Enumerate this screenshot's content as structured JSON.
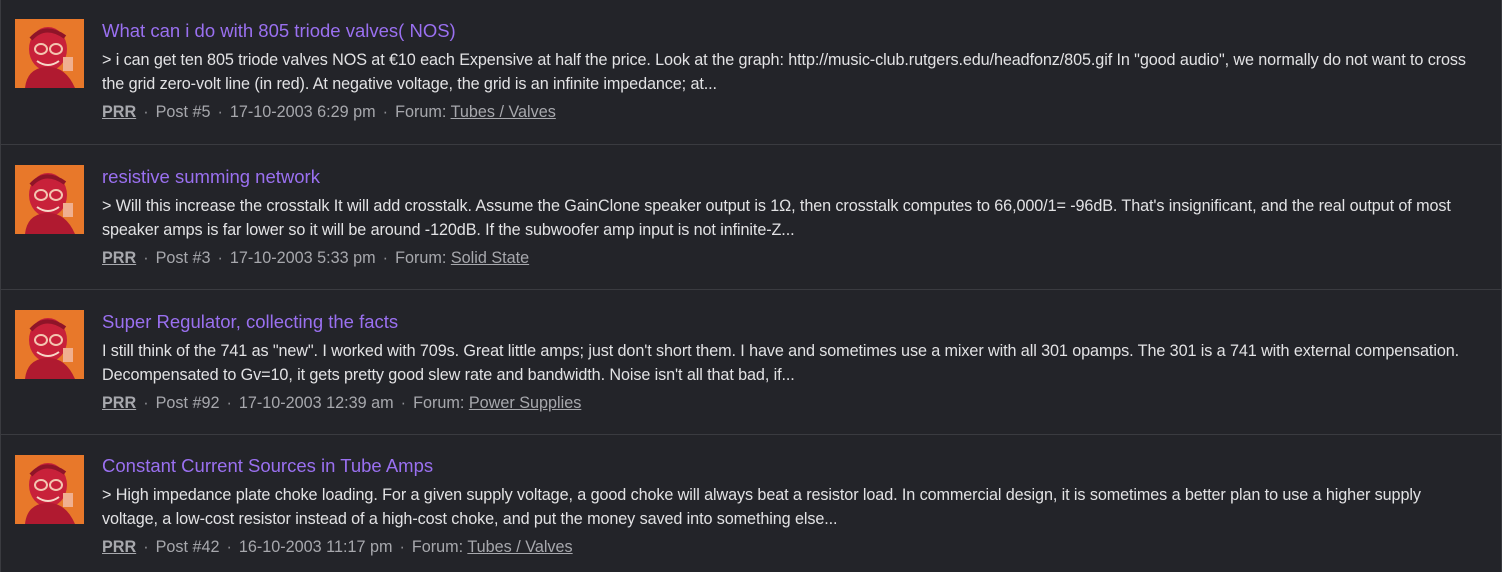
{
  "results": [
    {
      "title": "What can i do with 805 triode valves( NOS)",
      "snippet": "> i can get ten 805 triode valves NOS at €10 each Expensive at half the price. Look at the graph: http://music-club.rutgers.edu/headfonz/805.gif In \"good audio\", we normally do not want to cross the grid zero-volt line (in red). At negative voltage, the grid is an infinite impedance; at...",
      "user": "PRR",
      "post": "Post #5",
      "date": "17-10-2003 6:29 pm",
      "forum_label": "Forum:",
      "forum": "Tubes / Valves"
    },
    {
      "title": "resistive summing network",
      "snippet": "> Will this increase the crosstalk It will add crosstalk. Assume the GainClone speaker output is 1Ω, then crosstalk computes to 66,000/1= -96dB. That's insignificant, and the real output of most speaker amps is far lower so it will be around -120dB. If the subwoofer amp input is not infinite-Z...",
      "user": "PRR",
      "post": "Post #3",
      "date": "17-10-2003 5:33 pm",
      "forum_label": "Forum:",
      "forum": "Solid State"
    },
    {
      "title": "Super Regulator, collecting the facts",
      "snippet": "I still think of the 741 as \"new\". I worked with 709s. Great little amps; just don't short them. I have and sometimes use a mixer with all 301 opamps. The 301 is a 741 with external compensation. Decompensated to Gv=10, it gets pretty good slew rate and bandwidth. Noise isn't all that bad, if...",
      "user": "PRR",
      "post": "Post #92",
      "date": "17-10-2003 12:39 am",
      "forum_label": "Forum:",
      "forum": "Power Supplies"
    },
    {
      "title": "Constant Current Sources in Tube Amps",
      "snippet": "> High impedance plate choke loading. For a given supply voltage, a good choke will always beat a resistor load. In commercial design, it is sometimes a better plan to use a higher supply voltage, a low-cost resistor instead of a high-cost choke, and put the money saved into something else...",
      "user": "PRR",
      "post": "Post #42",
      "date": "16-10-2003 11:17 pm",
      "forum_label": "Forum:",
      "forum": "Tubes / Valves"
    }
  ],
  "separator": "·",
  "colors": {
    "background": "#232429",
    "title_link": "#9a70f0",
    "snippet_text": "#e2e2e4",
    "meta_text": "#a7a8ad",
    "divider": "#3a3b40",
    "avatar_bg": "#e8782a",
    "avatar_figure": "#c8213a"
  },
  "icons": {
    "avatar": "user-avatar-image"
  }
}
